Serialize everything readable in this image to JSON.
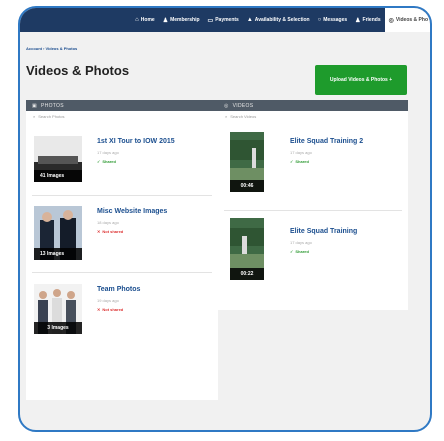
{
  "nav": {
    "items": [
      {
        "icon": "⌂",
        "label": "Home"
      },
      {
        "icon": "♟",
        "label": "Membership"
      },
      {
        "icon": "▭",
        "label": "Payments"
      },
      {
        "icon": "▲",
        "label": "Availability & Selection"
      },
      {
        "icon": "○",
        "label": "Messages"
      },
      {
        "icon": "♟",
        "label": "Friends"
      }
    ],
    "active": {
      "icon": "◎",
      "label": "Videos & Pho"
    }
  },
  "breadcrumb": "Account › Videos & Photos",
  "page_title": "Videos & Photos",
  "upload_button": "Upload Videos & Photos +",
  "photos": {
    "header": "PHOTOS",
    "search_placeholder": "Search Photos",
    "items": [
      {
        "title": "1st XI Tour to IOW 2015",
        "date": "17 days ago",
        "status": "Shared",
        "count": "41 Images"
      },
      {
        "title": "Misc Website Images",
        "date": "18 days ago",
        "status": "Not shared",
        "count": "13 Images"
      },
      {
        "title": "Team Photos",
        "date": "19 days ago",
        "status": "Not shared",
        "count": "3 Images"
      }
    ]
  },
  "videos": {
    "header": "VIDEOS",
    "search_placeholder": "Search Videos",
    "items": [
      {
        "title": "Elite Squad Training 2",
        "date": "17 days ago",
        "status": "Shared",
        "duration": "00:46"
      },
      {
        "title": "Elite Squad Training",
        "date": "17 days ago",
        "status": "Shared",
        "duration": "00:22"
      }
    ]
  },
  "colors": {
    "nav": "#1e3a63",
    "primary": "#1e9b2c",
    "link": "#1c4f8f",
    "frame": "#2f79c4"
  }
}
